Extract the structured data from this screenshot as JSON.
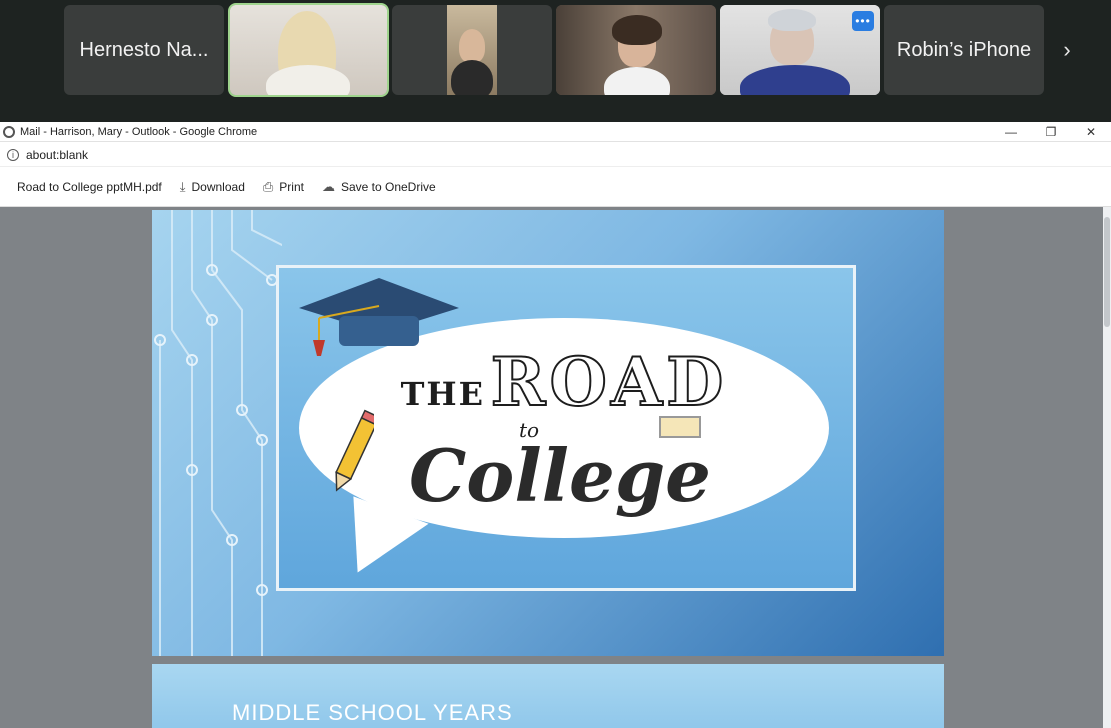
{
  "meeting": {
    "participants": [
      {
        "name": "Hernesto Na...",
        "type": "name"
      },
      {
        "name": "",
        "type": "video",
        "speaking": true
      },
      {
        "name": "",
        "type": "video"
      },
      {
        "name": "",
        "type": "video"
      },
      {
        "name": "",
        "type": "video",
        "has_more": true
      },
      {
        "name": "Robin’s iPhone",
        "type": "name"
      }
    ],
    "more_label": "•••",
    "next_label": "›"
  },
  "window": {
    "title": "Mail - Harrison, Mary - Outlook - Google Chrome",
    "minimize": "—",
    "restore": "❐",
    "close": "✕"
  },
  "address": {
    "url": "about:blank"
  },
  "pdf_toolbar": {
    "filename": "Road to College pptMH.pdf",
    "download": "Download",
    "print": "Print",
    "onedrive": "Save to OneDrive"
  },
  "slides": {
    "slide1": {
      "the": "THE",
      "road": "ROAD",
      "to": "to",
      "college": "College"
    },
    "slide2": {
      "heading": "MIDDLE SCHOOL YEARS"
    }
  },
  "colors": {
    "speaking_outline": "#9fd48d",
    "more_button": "#2a7de1",
    "viewer_bg": "#7f8387"
  }
}
